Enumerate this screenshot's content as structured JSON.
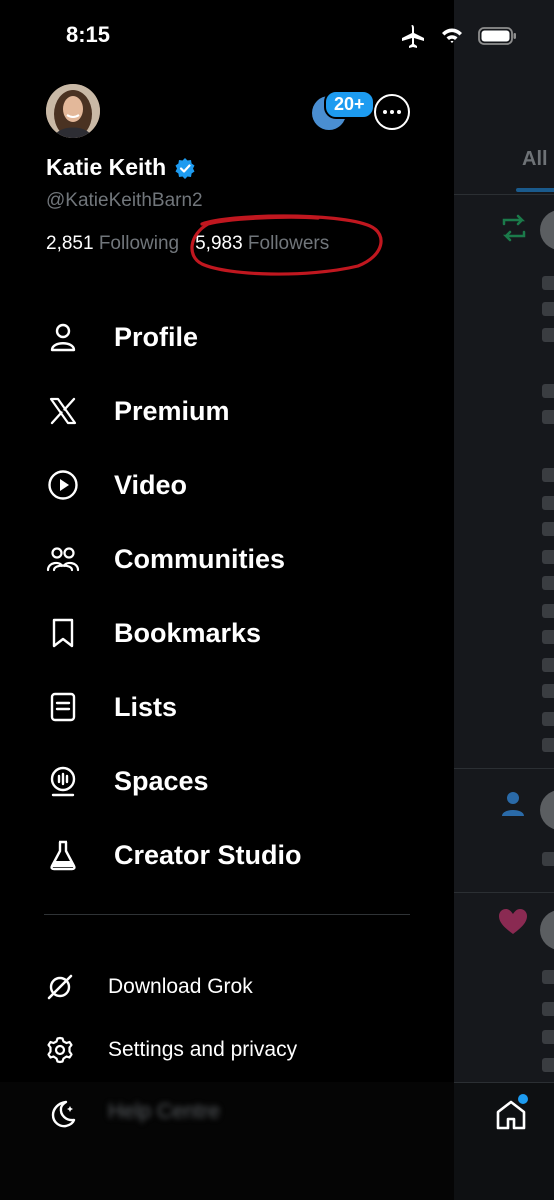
{
  "status": {
    "time": "8:15"
  },
  "profile": {
    "name": "Katie Keith",
    "handle": "@KatieKeithBarn2",
    "following_count": "2,851",
    "following_label": "Following",
    "followers_count": "5,983",
    "followers_label": "Followers",
    "notification_badge": "20+"
  },
  "menu": [
    {
      "label": "Profile",
      "icon": "person-icon"
    },
    {
      "label": "Premium",
      "icon": "x-logo-icon"
    },
    {
      "label": "Video",
      "icon": "play-circle-icon"
    },
    {
      "label": "Communities",
      "icon": "communities-icon"
    },
    {
      "label": "Bookmarks",
      "icon": "bookmark-icon"
    },
    {
      "label": "Lists",
      "icon": "list-icon"
    },
    {
      "label": "Spaces",
      "icon": "spaces-icon"
    },
    {
      "label": "Creator Studio",
      "icon": "flask-icon"
    }
  ],
  "secondary_menu": [
    {
      "label": "Download Grok",
      "icon": "grok-icon"
    },
    {
      "label": "Settings and privacy",
      "icon": "gear-icon"
    }
  ],
  "footer": {
    "help_label": "Help Centre"
  },
  "background_feed": {
    "tab_label": "All"
  },
  "colors": {
    "accent": "#1d9bf0",
    "verified": "#1d9bf0",
    "annotation": "#c0171f"
  }
}
